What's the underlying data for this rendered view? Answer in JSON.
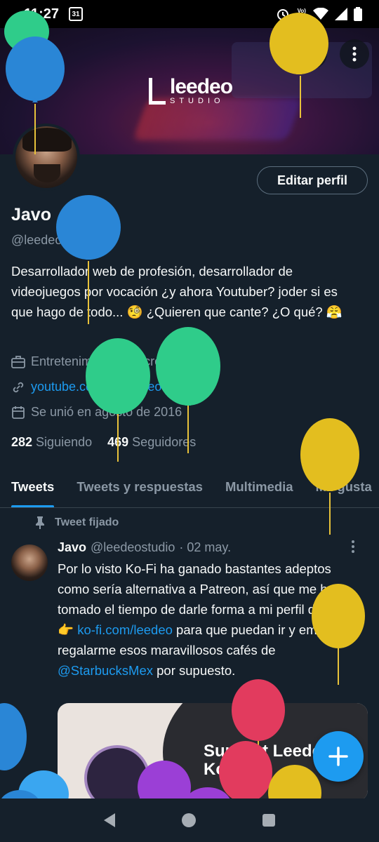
{
  "status_bar": {
    "time": "11:27",
    "calendar_badge": "31",
    "network_label": "Vo) LTE"
  },
  "profile": {
    "brand_name": "leedeo",
    "brand_sub": "STUDIO",
    "edit_button": "Editar perfil",
    "name": "Javo",
    "handle": "@leedeostudio",
    "bio": "Desarrollador web de profesión, desarrollador de videojuegos por vocación ¿y ahora Youtuber? joder si es que hago de todo... 🧐 ¿Quieren que cante? ¿O qué? 😤",
    "category": "Entretenimiento y recreación",
    "website": "youtube.com/@Leedeo",
    "joined": "Se unió en agosto de 2016",
    "following_count": "282",
    "following_label": "Siguiendo",
    "followers_count": "469",
    "followers_label": "Seguidores"
  },
  "tabs": [
    {
      "label": "Tweets"
    },
    {
      "label": "Tweets y respuestas"
    },
    {
      "label": "Multimedia"
    },
    {
      "label": "Me gusta"
    }
  ],
  "pinned_tweet": {
    "pinned_label": "Tweet fijado",
    "author": "Javo",
    "handle": "@leedeostudio",
    "date": "· 02 may.",
    "text_1": "Por lo visto Ko-Fi ha ganado bastantes adeptos como sería alternativa a Patreon, así que me he tomado el tiempo de darle forma a mi perfil de Ko-Fi 👉 ",
    "link_1": "ko-fi.com/leedeo",
    "text_2": " para que puedan ir y empezar a regalarme esos maravillosos cafés de ",
    "mention": "@StarbucksMex",
    "text_3": " por supuesto.",
    "card_title": "Support Leedeo on Ko-Fi"
  },
  "colors": {
    "background": "#15202b",
    "accent": "#1d9bf0",
    "muted": "#8b98a5",
    "divider": "#38444d"
  },
  "icons": [
    "search-icon",
    "more-icon",
    "briefcase-icon",
    "link-icon",
    "calendar-icon",
    "info-icon",
    "pin-icon",
    "compose-icon"
  ]
}
